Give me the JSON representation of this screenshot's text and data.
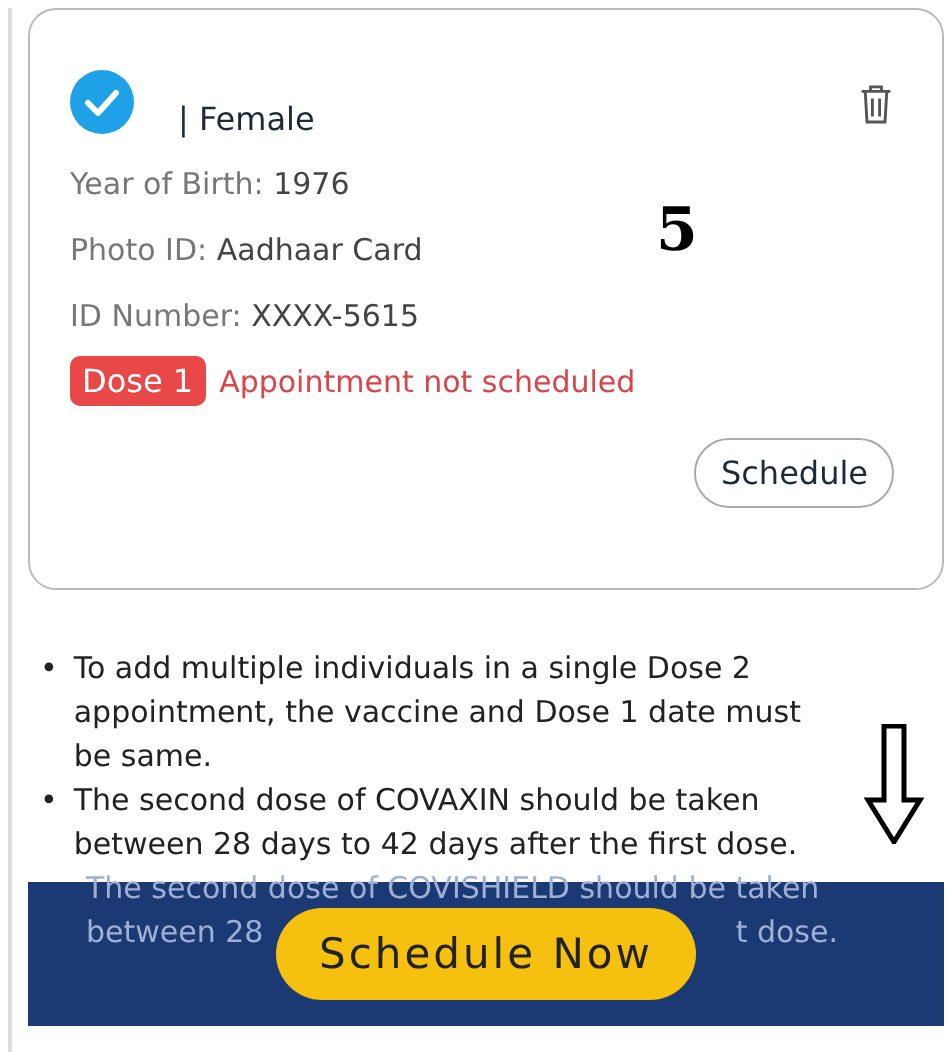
{
  "card": {
    "checked": true,
    "gender": "| Female",
    "fields": [
      {
        "label": "Year of Birth:",
        "value": "1976"
      },
      {
        "label": "Photo ID:",
        "value": "Aadhaar Card"
      },
      {
        "label": "ID Number:",
        "value": "XXXX-5615"
      }
    ],
    "dose_badge": "Dose 1",
    "status": "Appointment not scheduled",
    "button": "Schedule"
  },
  "notes": [
    {
      "bullet": "•",
      "text": "To add multiple individuals in a single Dose 2 appointment, the vaccine and Dose 1 date must be same."
    },
    {
      "bullet": "•",
      "text": "The second dose of COVAXIN should be taken between 28 days to 42 days after the first dose."
    }
  ],
  "covered_note": {
    "line_1": "The second dose of COVISHIELD should be taken",
    "line_2_start": "between 28",
    "line_2_end": "t dose."
  },
  "bottom_bar": {
    "button": "Schedule Now"
  },
  "annotation": {
    "number": "5"
  }
}
